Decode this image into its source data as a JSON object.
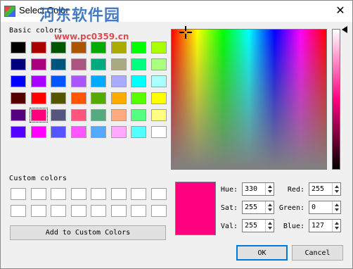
{
  "window": {
    "title": "Select Color",
    "watermark_text": "河东软件园",
    "watermark_url": "www.pc0359.cn",
    "close_glyph": "✕"
  },
  "basic_colors": {
    "label": "Basic colors",
    "swatches": [
      "#000000",
      "#aa0000",
      "#005500",
      "#aa5500",
      "#00aa00",
      "#aaaa00",
      "#00ff00",
      "#aaff00",
      "#00007f",
      "#aa007f",
      "#00557f",
      "#aa557f",
      "#00aa7f",
      "#aaaa7f",
      "#00ff7f",
      "#aaff7f",
      "#0000ff",
      "#aa00ff",
      "#0055ff",
      "#aa55ff",
      "#00aaff",
      "#aaaaff",
      "#00ffff",
      "#aaffff",
      "#550000",
      "#ff0000",
      "#555500",
      "#ff5500",
      "#55aa00",
      "#ffaa00",
      "#55ff00",
      "#ffff00",
      "#55007f",
      "#ff007f",
      "#55557f",
      "#ff557f",
      "#55aa7f",
      "#ffaa7f",
      "#55ff7f",
      "#ffff7f",
      "#5500ff",
      "#ff00ff",
      "#5555ff",
      "#ff55ff",
      "#55aaff",
      "#ffaaff",
      "#55ffff",
      "#ffffff"
    ],
    "selected_index": 33
  },
  "custom_colors": {
    "label": "Custom colors",
    "swatches": [
      "#ffffff",
      "#ffffff",
      "#ffffff",
      "#ffffff",
      "#ffffff",
      "#ffffff",
      "#ffffff",
      "#ffffff",
      "#ffffff",
      "#ffffff",
      "#ffffff",
      "#ffffff",
      "#ffffff",
      "#ffffff",
      "#ffffff",
      "#ffffff"
    ]
  },
  "add_custom_button": "Add to Custom Colors",
  "current_color": "#ff007f",
  "fields": {
    "hue": {
      "label": "Hue:",
      "value": "330"
    },
    "sat": {
      "label": "Sat:",
      "value": "255"
    },
    "val": {
      "label": "Val:",
      "value": "255"
    },
    "red": {
      "label": "Red:",
      "value": "255"
    },
    "green": {
      "label": "Green:",
      "value": "0"
    },
    "blue": {
      "label": "Blue:",
      "value": "127"
    }
  },
  "buttons": {
    "ok": "OK",
    "cancel": "Cancel"
  }
}
